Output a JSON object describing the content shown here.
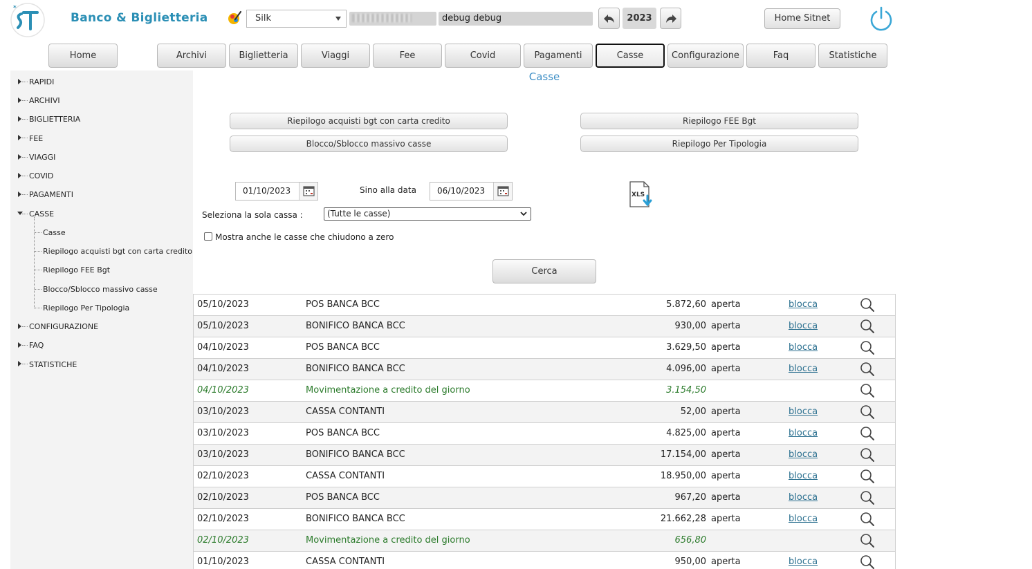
{
  "header": {
    "app_title": "Banco & Biglietteria",
    "theme": "Silk",
    "user_name": "debug debug",
    "year": "2023",
    "home_sitnet": "Home Sitnet"
  },
  "menu": [
    {
      "label": "Home"
    },
    {
      "label": "Archivi"
    },
    {
      "label": "Biglietteria"
    },
    {
      "label": "Viaggi"
    },
    {
      "label": "Fee"
    },
    {
      "label": "Covid"
    },
    {
      "label": "Pagamenti"
    },
    {
      "label": "Casse"
    },
    {
      "label": "Configurazione"
    },
    {
      "label": "Faq"
    },
    {
      "label": "Statistiche"
    }
  ],
  "sidebar": {
    "items": [
      {
        "label": "RAPIDI"
      },
      {
        "label": "ARCHIVI"
      },
      {
        "label": "BIGLIETTERIA"
      },
      {
        "label": "FEE"
      },
      {
        "label": "VIAGGI"
      },
      {
        "label": "COVID"
      },
      {
        "label": "PAGAMENTI"
      },
      {
        "label": "CASSE"
      },
      {
        "label": "CONFIGURAZIONE"
      },
      {
        "label": "FAQ"
      },
      {
        "label": "STATISTICHE"
      }
    ],
    "casse_children": [
      {
        "label": "Casse"
      },
      {
        "label": "Riepilogo acquisti bgt con carta credito"
      },
      {
        "label": "Riepilogo FEE Bgt"
      },
      {
        "label": "Blocco/Sblocco massivo casse"
      },
      {
        "label": "Riepilogo Per Tipologia"
      }
    ]
  },
  "main": {
    "title": "Casse",
    "buttons": {
      "riepilogo_carta": "Riepilogo acquisti bgt con carta credito",
      "blocco_massivo": "Blocco/Sblocco massivo casse",
      "riepilogo_fee": "Riepilogo FEE Bgt",
      "riepilogo_tipologia": "Riepilogo Per Tipologia"
    },
    "date_from": "01/10/2023",
    "date_to_label": "Sino alla data",
    "date_to": "06/10/2023",
    "cassa_label": "Seleziona la sola cassa :",
    "cassa_selected": "(Tutte le casse)",
    "checkbox_label": "Mostra anche le casse che chiudono a zero",
    "search_button": "Cerca"
  },
  "table": {
    "rows": [
      {
        "date": "05/10/2023",
        "desc": "POS BANCA BCC",
        "amount": "5.872,60",
        "status": "aperta",
        "link": "blocca",
        "type": "cassa"
      },
      {
        "date": "05/10/2023",
        "desc": "BONIFICO BANCA BCC",
        "amount": "930,00",
        "status": "aperta",
        "link": "blocca",
        "type": "cassa"
      },
      {
        "date": "04/10/2023",
        "desc": "POS BANCA BCC",
        "amount": "3.629,50",
        "status": "aperta",
        "link": "blocca",
        "type": "cassa"
      },
      {
        "date": "04/10/2023",
        "desc": "BONIFICO BANCA BCC",
        "amount": "4.096,00",
        "status": "aperta",
        "link": "blocca",
        "type": "cassa"
      },
      {
        "date": "04/10/2023",
        "desc": "Movimentazione a credito del giorno",
        "amount": "3.154,50",
        "status": "",
        "link": "",
        "type": "credit"
      },
      {
        "date": "03/10/2023",
        "desc": "CASSA CONTANTI",
        "amount": "52,00",
        "status": "aperta",
        "link": "blocca",
        "type": "cassa"
      },
      {
        "date": "03/10/2023",
        "desc": "POS BANCA BCC",
        "amount": "4.825,00",
        "status": "aperta",
        "link": "blocca",
        "type": "cassa"
      },
      {
        "date": "03/10/2023",
        "desc": "BONIFICO BANCA BCC",
        "amount": "17.154,00",
        "status": "aperta",
        "link": "blocca",
        "type": "cassa"
      },
      {
        "date": "02/10/2023",
        "desc": "CASSA CONTANTI",
        "amount": "18.950,00",
        "status": "aperta",
        "link": "blocca",
        "type": "cassa"
      },
      {
        "date": "02/10/2023",
        "desc": "POS BANCA BCC",
        "amount": "967,20",
        "status": "aperta",
        "link": "blocca",
        "type": "cassa"
      },
      {
        "date": "02/10/2023",
        "desc": "BONIFICO BANCA BCC",
        "amount": "21.662,28",
        "status": "aperta",
        "link": "blocca",
        "type": "cassa"
      },
      {
        "date": "02/10/2023",
        "desc": "Movimentazione a credito del giorno",
        "amount": "656,80",
        "status": "",
        "link": "",
        "type": "credit"
      },
      {
        "date": "01/10/2023",
        "desc": "CASSA CONTANTI",
        "amount": "950,00",
        "status": "aperta",
        "link": "blocca",
        "type": "cassa"
      }
    ]
  },
  "colors": {
    "brand": "#2b8fb5",
    "title": "#3f8fc6",
    "credit_text": "#2a7a2a",
    "link": "#2a6f8f"
  },
  "icons": [
    "logo-icon",
    "theme-palette-icon",
    "back-arrow-icon",
    "forward-arrow-icon",
    "power-icon",
    "calendar-icon",
    "xls-export-icon",
    "magnifier-icon"
  ]
}
